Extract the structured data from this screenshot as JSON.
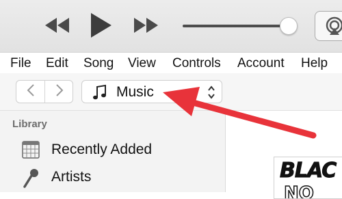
{
  "toolbar": {
    "rewind_icon": "rewind-icon",
    "play_icon": "play-icon",
    "fast_forward_icon": "fast-forward-icon",
    "volume_level": 0.92,
    "airplay_icon": "airplay-icon"
  },
  "menubar": {
    "items": [
      {
        "label": "File"
      },
      {
        "label": "Edit"
      },
      {
        "label": "Song"
      },
      {
        "label": "View"
      },
      {
        "label": "Controls"
      },
      {
        "label": "Account"
      },
      {
        "label": "Help"
      }
    ]
  },
  "nav": {
    "back_icon": "chevron-left-icon",
    "forward_icon": "chevron-right-icon",
    "media_picker": {
      "icon": "music-note-icon",
      "selected": "Music",
      "chevron_icon": "up-down-chevron-icon"
    }
  },
  "sidebar": {
    "heading": "Library",
    "items": [
      {
        "label": "Recently Added",
        "icon": "calendar-grid-icon"
      },
      {
        "label": "Artists",
        "icon": "microphone-icon"
      }
    ]
  },
  "main": {
    "album_text_line1": "BLAC",
    "album_text_line2": "NO"
  },
  "annotation": {
    "arrow_color": "#e8333a",
    "arrow_icon": "annotation-arrow-icon"
  },
  "colors": {
    "toolbar_bg": "#e6e6e6",
    "sidebar_bg": "#f3f3f3",
    "icon_dark": "#4a4a4a"
  }
}
